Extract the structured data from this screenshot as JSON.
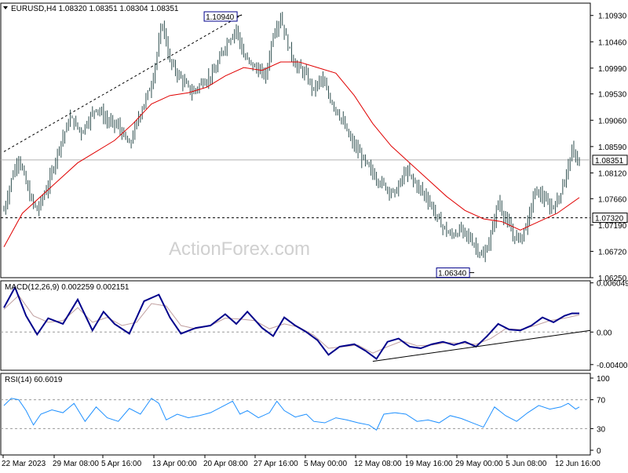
{
  "header": {
    "main_title": "EURUSD,H4 1.08320 1.08351 1.08304 1.08351",
    "macd_title": "MACD(12,26,9) 0.002259 0.002151",
    "rsi_title": "RSI(14) 60.6019"
  },
  "watermark": "ActionForex.com",
  "colors": {
    "candle": "#2f4f4f",
    "ma": "#e00000",
    "macd_line": "#00008b",
    "macd_signal": "#c0a0a0",
    "rsi_line": "#1e90ff",
    "trendline": "#000000",
    "grid": "#c0c0c0",
    "label_fill": "#ffffff",
    "price_box_fill": "#ffffff"
  },
  "chart_data": [
    {
      "type": "candlestick",
      "title": "EURUSD,H4",
      "symbol": "EURUSD",
      "timeframe": "H4",
      "last": {
        "open": 1.0832,
        "high": 1.08351,
        "low": 1.08304,
        "close": 1.08351
      },
      "ylim": [
        1.0625,
        1.1115
      ],
      "y_ticks": [
        "1.10930",
        "1.10460",
        "1.09990",
        "1.09530",
        "1.09060",
        "1.08590",
        "1.08120",
        "1.07660",
        "1.07190",
        "1.06720",
        "1.06250"
      ],
      "x_ticks": [
        "22 Mar 2023",
        "29 Mar 08:00",
        "5 Apr 16:00",
        "13 Apr 00:00",
        "20 Apr 08:00",
        "27 Apr 16:00",
        "5 May 00:00",
        "12 May 08:00",
        "19 May 16:00",
        "29 May 00:00",
        "5 Jun 08:00",
        "12 Jun 16:00"
      ],
      "close_path": [
        [
          0,
          1.0745
        ],
        [
          4,
          1.08
        ],
        [
          8,
          1.084
        ],
        [
          14,
          1.077
        ],
        [
          18,
          1.0745
        ],
        [
          24,
          1.079
        ],
        [
          30,
          1.086
        ],
        [
          36,
          1.091
        ],
        [
          42,
          1.0885
        ],
        [
          50,
          1.093
        ],
        [
          56,
          1.0905
        ],
        [
          62,
          1.0895
        ],
        [
          68,
          1.086
        ],
        [
          74,
          1.092
        ],
        [
          80,
          1.097
        ],
        [
          86,
          1.108
        ],
        [
          90,
          1.101
        ],
        [
          96,
          1.098
        ],
        [
          102,
          1.0955
        ],
        [
          108,
          1.0975
        ],
        [
          114,
          1.099
        ],
        [
          120,
          1.104
        ],
        [
          126,
          1.107
        ],
        [
          130,
          1.102
        ],
        [
          136,
          1.1
        ],
        [
          142,
          1.0985
        ],
        [
          146,
          1.106
        ],
        [
          150,
          1.109
        ],
        [
          154,
          1.104
        ],
        [
          158,
          1.1005
        ],
        [
          163,
          1.099
        ],
        [
          168,
          1.096
        ],
        [
          172,
          1.098
        ],
        [
          176,
          1.095
        ],
        [
          182,
          1.0915
        ],
        [
          188,
          1.087
        ],
        [
          194,
          1.084
        ],
        [
          200,
          1.081
        ],
        [
          206,
          1.079
        ],
        [
          212,
          1.0775
        ],
        [
          218,
          1.0815
        ],
        [
          224,
          1.079
        ],
        [
          230,
          1.0765
        ],
        [
          236,
          1.0725
        ],
        [
          242,
          1.07
        ],
        [
          248,
          1.071
        ],
        [
          254,
          1.069
        ],
        [
          260,
          1.066
        ],
        [
          264,
          1.07
        ],
        [
          268,
          1.076
        ],
        [
          272,
          1.073
        ],
        [
          276,
          1.07
        ],
        [
          280,
          1.0695
        ],
        [
          284,
          1.0725
        ],
        [
          288,
          1.078
        ],
        [
          292,
          1.077
        ],
        [
          296,
          1.075
        ],
        [
          300,
          1.076
        ],
        [
          304,
          1.08
        ],
        [
          308,
          1.085
        ],
        [
          312,
          1.0835
        ]
      ],
      "series": [
        {
          "name": "MA",
          "values": [
            [
              0,
              1.068
            ],
            [
              10,
              1.074
            ],
            [
              20,
              1.077
            ],
            [
              30,
              1.08
            ],
            [
              40,
              1.083
            ],
            [
              50,
              1.085
            ],
            [
              60,
              1.087
            ],
            [
              70,
              1.09
            ],
            [
              80,
              1.0935
            ],
            [
              90,
              1.095
            ],
            [
              100,
              1.0955
            ],
            [
              110,
              1.0965
            ],
            [
              120,
              1.0985
            ],
            [
              130,
              1.1
            ],
            [
              140,
              1.0995
            ],
            [
              150,
              1.101
            ],
            [
              160,
              1.101
            ],
            [
              170,
              1.1
            ],
            [
              180,
              1.099
            ],
            [
              190,
              1.095
            ],
            [
              200,
              1.09
            ],
            [
              210,
              1.086
            ],
            [
              220,
              1.083
            ],
            [
              230,
              1.08
            ],
            [
              240,
              1.077
            ],
            [
              250,
              1.0745
            ],
            [
              260,
              1.073
            ],
            [
              270,
              1.0725
            ],
            [
              280,
              1.071
            ],
            [
              290,
              1.0725
            ],
            [
              300,
              1.074
            ],
            [
              312,
              1.0768
            ]
          ]
        }
      ],
      "annotations": [
        {
          "text": "1.10940",
          "x": 129,
          "y": 1.1094
        },
        {
          "text": "1.06340",
          "x": 255,
          "y": 1.0634
        },
        {
          "text": "1.08351",
          "kind": "price_line",
          "y": 1.08351
        },
        {
          "text": "1.07320",
          "kind": "dashed_level",
          "y": 1.0732
        },
        {
          "text": "rising trendline",
          "kind": "dashed_trend",
          "from": [
            0,
            1.085
          ],
          "to": [
            129,
            1.1094
          ]
        }
      ]
    },
    {
      "type": "line",
      "title": "MACD(12,26,9)",
      "values_label": "0.002259 0.002151",
      "ylim": [
        -0.0047,
        0.0063
      ],
      "y_ticks": [
        "0.006049",
        "0.00",
        "-0.004005"
      ],
      "series": [
        {
          "name": "MACD",
          "values": [
            [
              0,
              0.003
            ],
            [
              6,
              0.0055
            ],
            [
              12,
              0.002
            ],
            [
              18,
              -0.0003
            ],
            [
              24,
              0.0017
            ],
            [
              32,
              0.001
            ],
            [
              40,
              0.004
            ],
            [
              48,
              0.0002
            ],
            [
              54,
              0.0025
            ],
            [
              60,
              0.001
            ],
            [
              68,
              -0.0002
            ],
            [
              76,
              0.0038
            ],
            [
              84,
              0.0046
            ],
            [
              90,
              0.0018
            ],
            [
              96,
              -0.0002
            ],
            [
              104,
              0.0005
            ],
            [
              112,
              0.0008
            ],
            [
              120,
              0.0022
            ],
            [
              126,
              0.001
            ],
            [
              132,
              0.0025
            ],
            [
              140,
              0.0005
            ],
            [
              146,
              -0.0005
            ],
            [
              152,
              0.0018
            ],
            [
              158,
              0.0008
            ],
            [
              164,
              0.0
            ],
            [
              170,
              -0.001
            ],
            [
              176,
              -0.0028
            ],
            [
              182,
              -0.0018
            ],
            [
              190,
              -0.0015
            ],
            [
              196,
              -0.0023
            ],
            [
              202,
              -0.0033
            ],
            [
              208,
              -0.0012
            ],
            [
              214,
              -0.0008
            ],
            [
              220,
              -0.0018
            ],
            [
              226,
              -0.002
            ],
            [
              232,
              -0.0015
            ],
            [
              238,
              -0.0012
            ],
            [
              244,
              -0.0016
            ],
            [
              250,
              -0.0012
            ],
            [
              256,
              -0.0018
            ],
            [
              262,
              -0.0005
            ],
            [
              268,
              0.001
            ],
            [
              274,
              0.0003
            ],
            [
              280,
              0.0002
            ],
            [
              286,
              0.0008
            ],
            [
              292,
              0.0018
            ],
            [
              298,
              0.0012
            ],
            [
              304,
              0.002
            ],
            [
              308,
              0.0023
            ],
            [
              312,
              0.0023
            ]
          ]
        },
        {
          "name": "Signal",
          "values": [
            [
              0,
              0.0028
            ],
            [
              8,
              0.0045
            ],
            [
              16,
              0.002
            ],
            [
              24,
              0.0012
            ],
            [
              32,
              0.0014
            ],
            [
              40,
              0.003
            ],
            [
              48,
              0.0012
            ],
            [
              56,
              0.0018
            ],
            [
              64,
              0.0008
            ],
            [
              72,
              0.0012
            ],
            [
              80,
              0.0035
            ],
            [
              88,
              0.0032
            ],
            [
              96,
              0.0008
            ],
            [
              104,
              0.0004
            ],
            [
              112,
              0.0008
            ],
            [
              120,
              0.0017
            ],
            [
              128,
              0.0016
            ],
            [
              136,
              0.0014
            ],
            [
              144,
              0.0004
            ],
            [
              152,
              0.001
            ],
            [
              160,
              0.0006
            ],
            [
              168,
              -0.0004
            ],
            [
              176,
              -0.002
            ],
            [
              184,
              -0.0018
            ],
            [
              192,
              -0.0016
            ],
            [
              200,
              -0.0026
            ],
            [
              208,
              -0.0018
            ],
            [
              216,
              -0.0011
            ],
            [
              224,
              -0.0017
            ],
            [
              232,
              -0.0016
            ],
            [
              240,
              -0.0013
            ],
            [
              248,
              -0.0014
            ],
            [
              256,
              -0.0015
            ],
            [
              264,
              -0.0008
            ],
            [
              272,
              0.0004
            ],
            [
              280,
              0.0003
            ],
            [
              288,
              0.0008
            ],
            [
              296,
              0.0014
            ],
            [
              304,
              0.0017
            ],
            [
              312,
              0.0021
            ]
          ]
        }
      ],
      "annotations": [
        {
          "text": "rising trendline",
          "kind": "trend",
          "from": [
            200,
            -0.0036
          ],
          "to": [
            312,
            0.0002
          ]
        }
      ]
    },
    {
      "type": "line",
      "title": "RSI(14)",
      "values_label": "60.6019",
      "ylim": [
        0,
        100
      ],
      "y_ticks": [
        "100",
        "70",
        "30",
        "0"
      ],
      "levels": [
        70,
        30
      ],
      "series": [
        {
          "name": "RSI",
          "values": [
            [
              0,
              62
            ],
            [
              4,
              72
            ],
            [
              8,
              70
            ],
            [
              12,
              55
            ],
            [
              16,
              35
            ],
            [
              20,
              50
            ],
            [
              26,
              56
            ],
            [
              32,
              52
            ],
            [
              38,
              65
            ],
            [
              44,
              40
            ],
            [
              50,
              60
            ],
            [
              56,
              45
            ],
            [
              62,
              40
            ],
            [
              68,
              58
            ],
            [
              74,
              50
            ],
            [
              80,
              72
            ],
            [
              84,
              65
            ],
            [
              88,
              42
            ],
            [
              94,
              50
            ],
            [
              100,
              45
            ],
            [
              106,
              48
            ],
            [
              112,
              52
            ],
            [
              118,
              60
            ],
            [
              124,
              68
            ],
            [
              128,
              50
            ],
            [
              132,
              55
            ],
            [
              138,
              45
            ],
            [
              144,
              52
            ],
            [
              148,
              68
            ],
            [
              152,
              55
            ],
            [
              158,
              46
            ],
            [
              164,
              50
            ],
            [
              168,
              40
            ],
            [
              174,
              38
            ],
            [
              180,
              45
            ],
            [
              186,
              42
            ],
            [
              192,
              38
            ],
            [
              198,
              35
            ],
            [
              202,
              28
            ],
            [
              206,
              50
            ],
            [
              212,
              52
            ],
            [
              218,
              50
            ],
            [
              224,
              40
            ],
            [
              230,
              42
            ],
            [
              236,
              38
            ],
            [
              242,
              48
            ],
            [
              248,
              44
            ],
            [
              254,
              38
            ],
            [
              260,
              32
            ],
            [
              266,
              60
            ],
            [
              272,
              48
            ],
            [
              278,
              40
            ],
            [
              284,
              52
            ],
            [
              290,
              62
            ],
            [
              296,
              57
            ],
            [
              302,
              60
            ],
            [
              306,
              65
            ],
            [
              310,
              57
            ],
            [
              312,
              60
            ]
          ]
        }
      ]
    }
  ]
}
